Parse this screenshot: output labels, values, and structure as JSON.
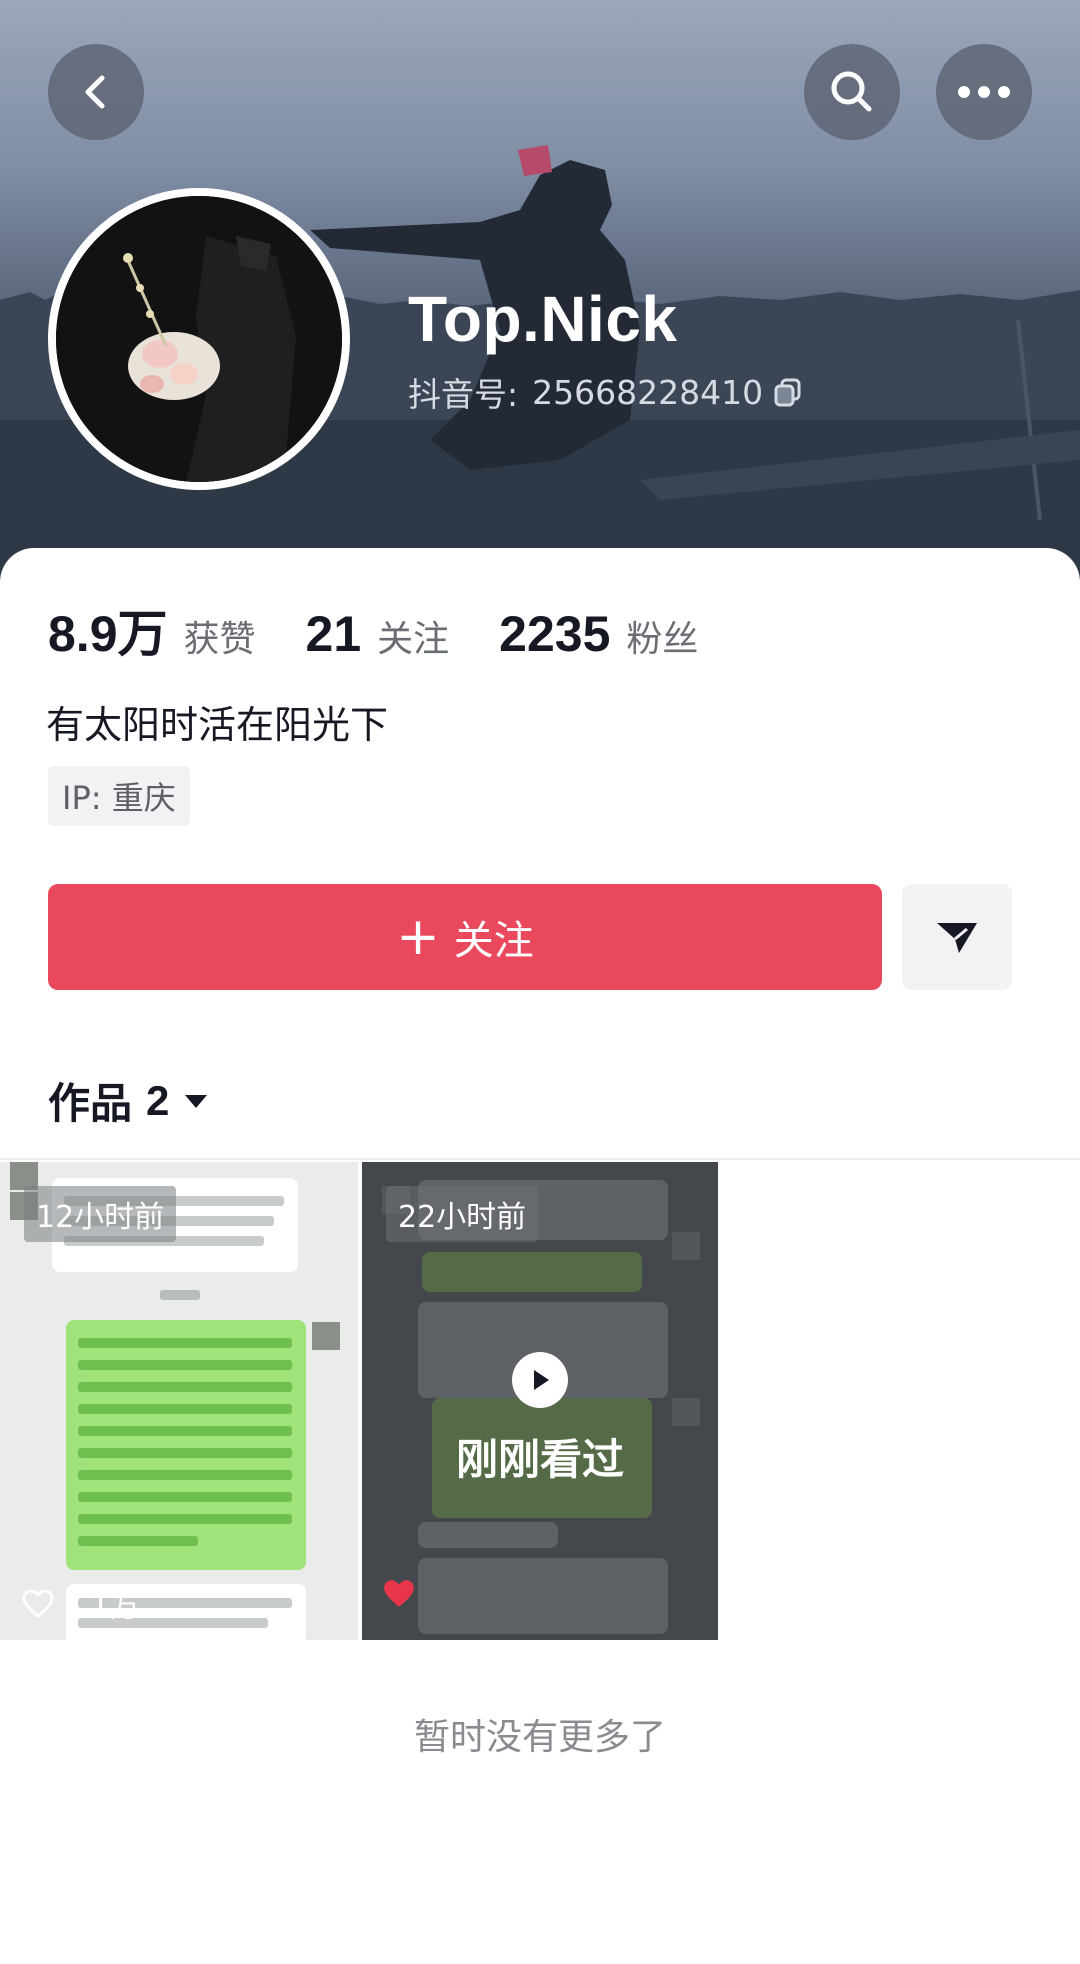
{
  "header": {
    "back_icon": "chevron-left-icon",
    "search_icon": "search-icon",
    "more_icon": "more-horizontal-icon"
  },
  "profile": {
    "nickname": "Top.Nick",
    "id_label": "抖音号:",
    "id_value": "25668228410",
    "copy_icon": "copy-icon",
    "stats": [
      {
        "value": "8.9万",
        "label": "获赞"
      },
      {
        "value": "21",
        "label": "关注"
      },
      {
        "value": "2235",
        "label": "粉丝"
      }
    ],
    "bio": "有太阳时活在阳光下",
    "ip": "IP:  重庆"
  },
  "actions": {
    "follow_label": "关注",
    "plus_glyph": "+",
    "send_icon": "send-message-icon"
  },
  "works": {
    "label": "作品",
    "count": "2",
    "videos": [
      {
        "time": "12小时前",
        "likes": "1.1万"
      },
      {
        "time": "22小时前",
        "status": "刚刚看过"
      }
    ]
  },
  "footer": {
    "end_note": "暂时没有更多了"
  },
  "colors": {
    "follow_button": "#e9485d",
    "chat_bubble_green": "#9fe37a"
  }
}
